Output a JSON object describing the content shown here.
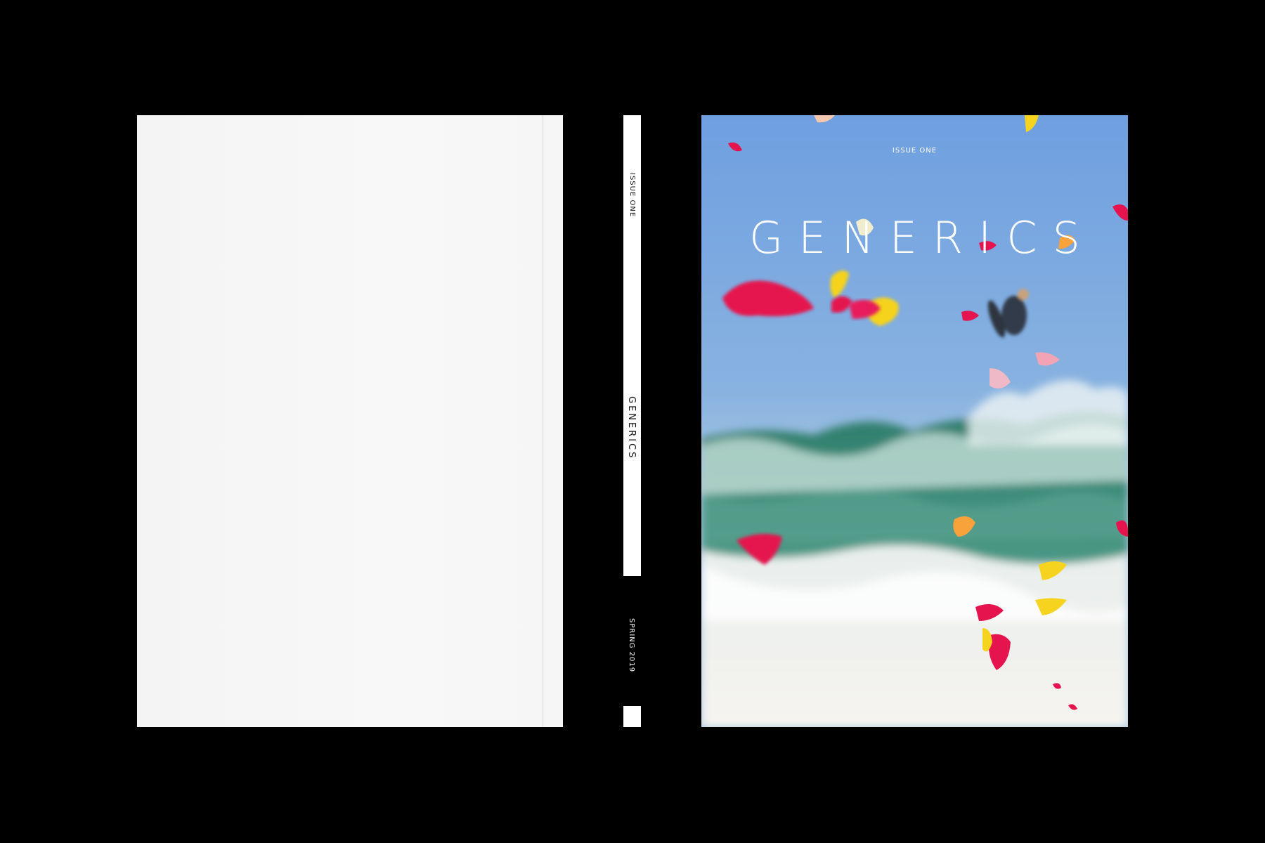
{
  "spine": {
    "issue": "ISSUE ONE",
    "title": "GENERICS",
    "season": "SPRING 2019"
  },
  "front_cover": {
    "issue": "ISSUE ONE",
    "title": "GENERICS"
  },
  "colors": {
    "background": "#000000",
    "back_cover": "#f6f6f6",
    "sky": "#7fa8dc",
    "wave": "#3f8c7c",
    "foam": "#f1f3f2",
    "petal_pink": "#e5144e",
    "petal_yellow": "#f5d31e"
  }
}
